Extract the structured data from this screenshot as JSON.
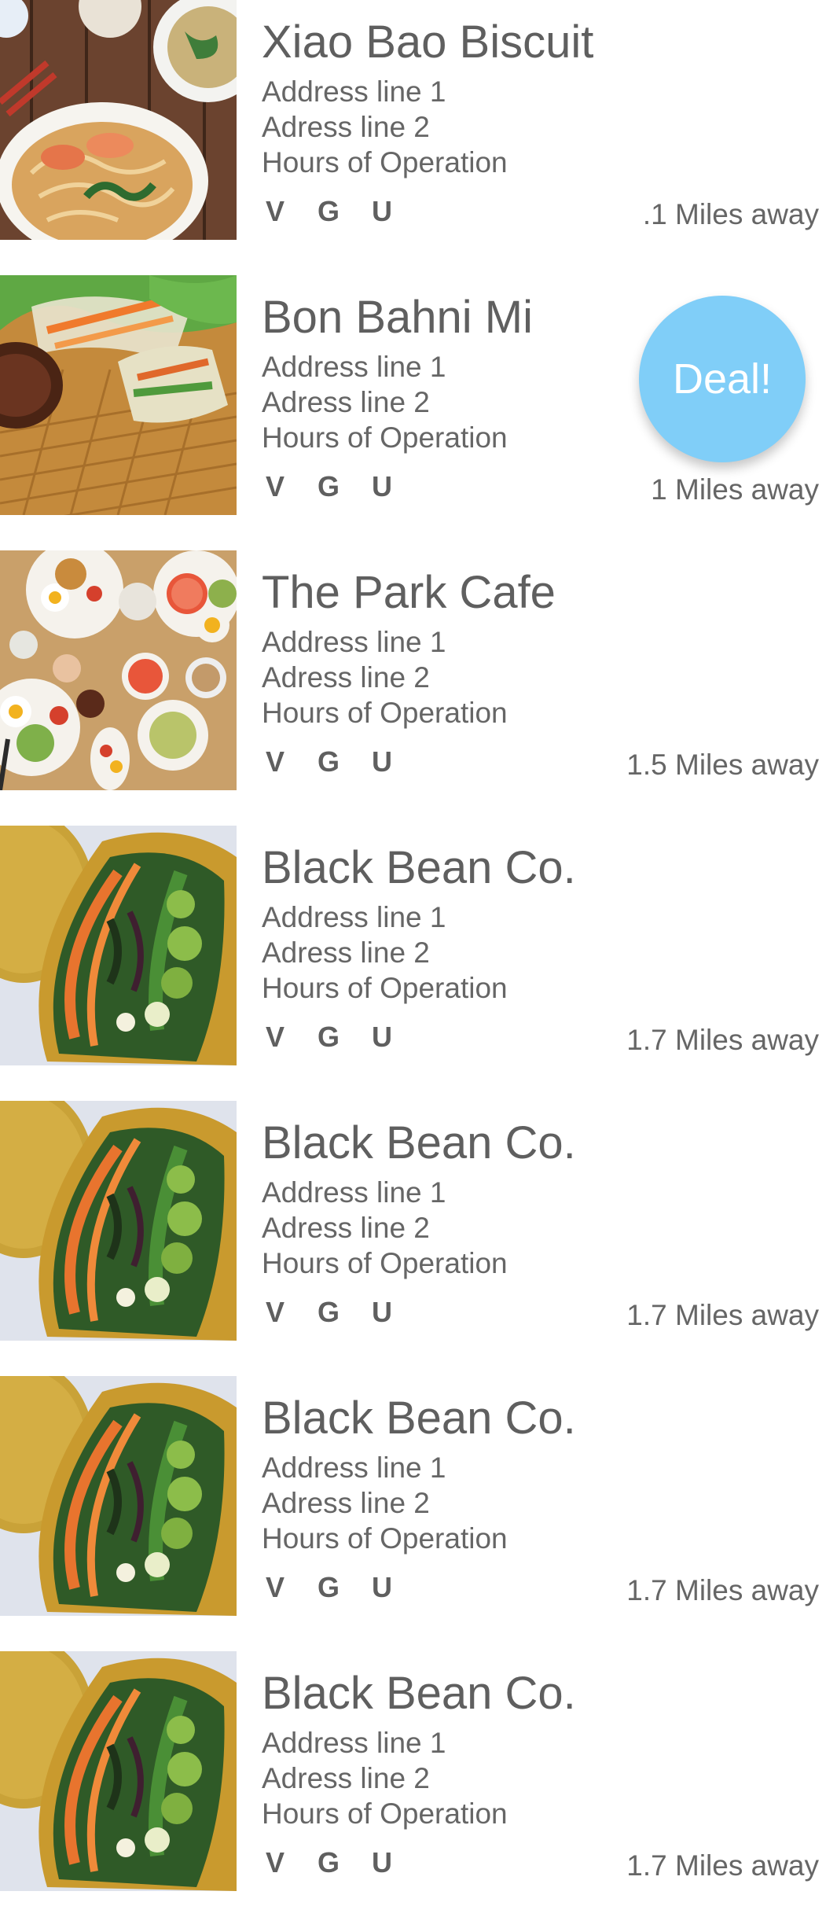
{
  "restaurants": [
    {
      "name": "Xiao Bao Biscuit",
      "address1": "Address line 1",
      "address2": "Adress line 2",
      "hours": "Hours of Operation",
      "tags": [
        "V",
        "G",
        "U"
      ],
      "distance": ".1 Miles away",
      "photo": "noodle-bowl-photo"
    },
    {
      "name": "Bon Bahni Mi",
      "address1": "Address line 1",
      "address2": "Adress line 2",
      "hours": "Hours of Operation",
      "tags": [
        "V",
        "G",
        "U"
      ],
      "distance": "1 Miles away",
      "deal": "Deal!",
      "photo": "spring-rolls-photo"
    },
    {
      "name": "The Park Cafe",
      "address1": "Address line 1",
      "address2": "Adress line 2",
      "hours": "Hours of Operation",
      "tags": [
        "V",
        "G",
        "U"
      ],
      "distance": "1.5 Miles away",
      "photo": "brunch-table-photo"
    },
    {
      "name": "Black Bean Co.",
      "address1": "Address line 1",
      "address2": "Adress line 2",
      "hours": "Hours of Operation",
      "tags": [
        "V",
        "G",
        "U"
      ],
      "distance": "1.7 Miles away",
      "photo": "veggie-wrap-photo"
    },
    {
      "name": "Black Bean Co.",
      "address1": "Address line 1",
      "address2": "Adress line 2",
      "hours": "Hours of Operation",
      "tags": [
        "V",
        "G",
        "U"
      ],
      "distance": "1.7 Miles away",
      "photo": "veggie-wrap-photo"
    },
    {
      "name": "Black Bean Co.",
      "address1": "Address line 1",
      "address2": "Adress line 2",
      "hours": "Hours of Operation",
      "tags": [
        "V",
        "G",
        "U"
      ],
      "distance": "1.7 Miles away",
      "photo": "veggie-wrap-photo"
    },
    {
      "name": "Black Bean Co.",
      "address1": "Address line 1",
      "address2": "Adress line 2",
      "hours": "Hours of Operation",
      "tags": [
        "V",
        "G",
        "U"
      ],
      "distance": "1.7 Miles away",
      "photo": "veggie-wrap-photo"
    }
  ],
  "colors": {
    "deal_badge": "#80cef8",
    "text": "#666666",
    "background": "#ffffff"
  }
}
